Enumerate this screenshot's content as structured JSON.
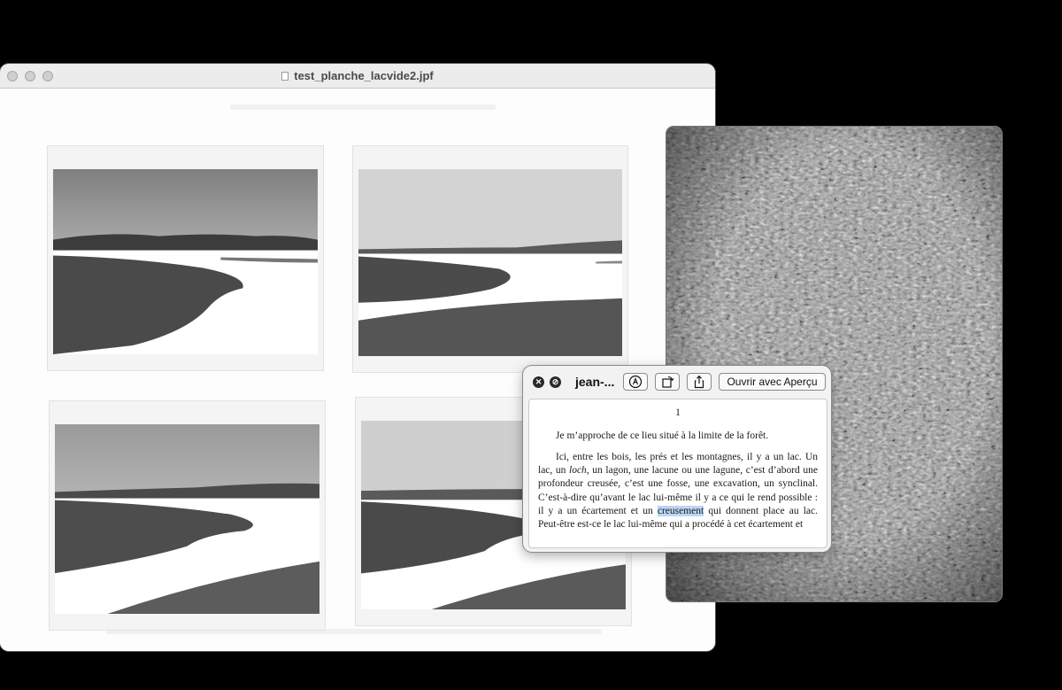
{
  "main_window": {
    "title": "test_planche_lacvide2.jpf"
  },
  "quicklook": {
    "file_name": "jean-...",
    "open_with_label": "Ouvrir avec Aperçu",
    "page_number": "1",
    "paragraph1": "Je m’approche de ce lieu situé à la limite de la forêt.",
    "p2_part1": "Ici, entre les bois, les prés et les montagnes, il y a un lac. Un lac, un ",
    "p2_loch": "loch",
    "p2_part2": ", un lagon, une lacune ou une lagune, c’est d’abord une profondeur creusée, c’est une fosse, une excavation, un synclinal. C’est-à-dire qu’avant le lac lui-même il y a ce qui le rend possible : il y a un écartement et un ",
    "p2_highlight": "creusement",
    "p2_part3": " qui donnent place au lac. Peut-être est-ce le lac lui-même qui a procédé à cet écartement et"
  },
  "icons": {
    "close": "close-circle-icon",
    "stop": "slash-circle-icon",
    "markup": "markup-pen-icon",
    "rotate": "rotate-icon",
    "share": "share-icon"
  }
}
